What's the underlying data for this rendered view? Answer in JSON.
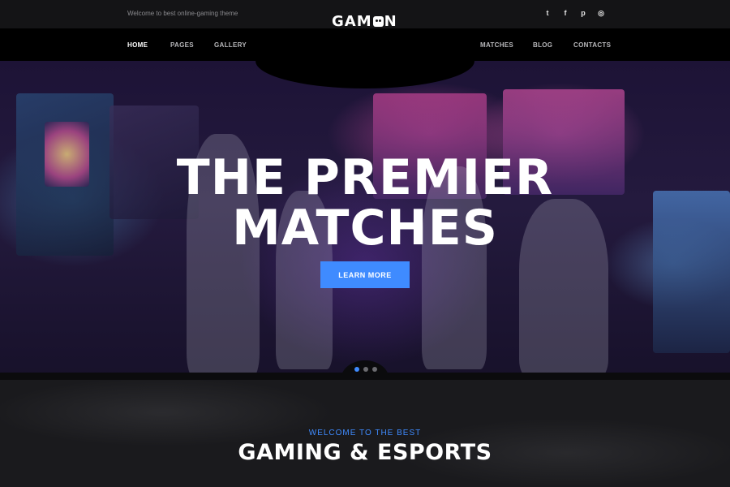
{
  "topbar": {
    "tagline": "Welcome to best online-gaming theme",
    "logo_before": "GAM",
    "logo_after": "N",
    "socials": [
      {
        "icon": "twitter-icon",
        "glyph": "t"
      },
      {
        "icon": "facebook-icon",
        "glyph": "f"
      },
      {
        "icon": "pinterest-icon",
        "glyph": "p"
      },
      {
        "icon": "instagram-icon",
        "glyph": "◎"
      }
    ]
  },
  "nav": {
    "left": [
      "HOME",
      "PAGES",
      "GALLERY"
    ],
    "right": [
      "MATCHES",
      "BLOG",
      "CONTACTS"
    ],
    "active": "HOME"
  },
  "hero": {
    "title_line1": "THE PREMIER",
    "title_line2": "MATCHES",
    "button": "LEARN MORE",
    "slides": 3,
    "active_slide": 1
  },
  "welcome": {
    "eyebrow": "WELCOME TO THE BEST",
    "title": "GAMING & ESPORTS"
  },
  "colors": {
    "accent": "#3f8bff",
    "background": "#0e0e10",
    "nav_bg": "#000000"
  }
}
